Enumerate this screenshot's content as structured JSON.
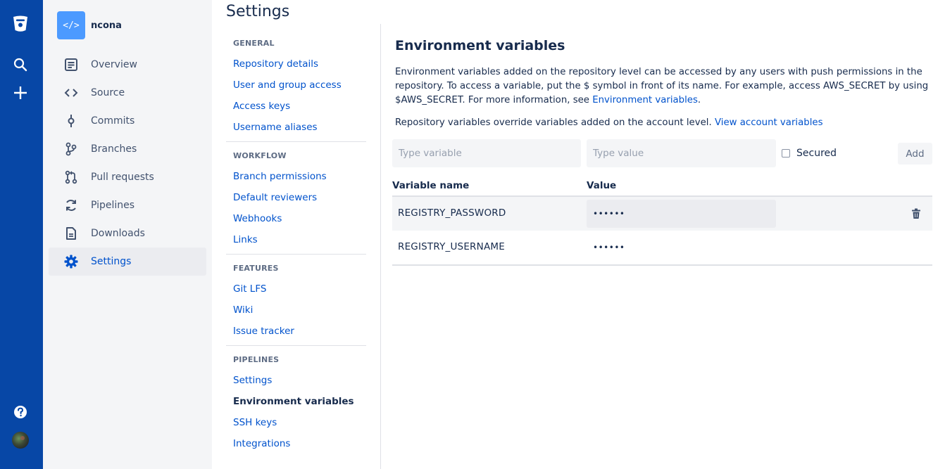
{
  "global_nav": {
    "icons": [
      "bitbucket-logo-icon",
      "search-icon",
      "create-plus-icon",
      "help-icon",
      "user-avatar"
    ]
  },
  "repo": {
    "avatar_text": "</>",
    "name": "ncona",
    "nav": [
      {
        "label": "Overview",
        "icon": "overview-icon"
      },
      {
        "label": "Source",
        "icon": "source-code-icon"
      },
      {
        "label": "Commits",
        "icon": "commit-icon"
      },
      {
        "label": "Branches",
        "icon": "branch-icon"
      },
      {
        "label": "Pull requests",
        "icon": "pull-request-icon"
      },
      {
        "label": "Pipelines",
        "icon": "pipelines-icon"
      },
      {
        "label": "Downloads",
        "icon": "downloads-icon"
      },
      {
        "label": "Settings",
        "icon": "gear-icon",
        "active": true
      }
    ]
  },
  "settings": {
    "title": "Settings",
    "sections": [
      {
        "heading": "GENERAL",
        "links": [
          "Repository details",
          "User and group access",
          "Access keys",
          "Username aliases"
        ]
      },
      {
        "heading": "WORKFLOW",
        "links": [
          "Branch permissions",
          "Default reviewers",
          "Webhooks",
          "Links"
        ]
      },
      {
        "heading": "FEATURES",
        "links": [
          "Git LFS",
          "Wiki",
          "Issue tracker"
        ]
      },
      {
        "heading": "PIPELINES",
        "links": [
          "Settings",
          "Environment variables",
          "SSH keys",
          "Integrations"
        ]
      }
    ],
    "current": "Environment variables"
  },
  "main": {
    "title": "Environment variables",
    "description_text": "Environment variables added on the repository level can be accessed by any users with push permissions in the repository. To access a variable, put the $ symbol in front of its name. For example, access AWS_SECRET by using $AWS_SECRET. For more information, see ",
    "description_link": "Environment variables",
    "description_end": ".",
    "override_text": "Repository variables override variables added on the account level. ",
    "override_link": "View account variables",
    "form": {
      "variable_placeholder": "Type variable",
      "value_placeholder": "Type value",
      "secured_label": "Secured",
      "secured_checked": false,
      "add_label": "Add"
    },
    "table": {
      "headers": [
        "Variable name",
        "Value"
      ],
      "rows": [
        {
          "name": "REGISTRY_PASSWORD",
          "value": "••••••"
        },
        {
          "name": "REGISTRY_USERNAME",
          "value": "••••••"
        }
      ]
    }
  }
}
